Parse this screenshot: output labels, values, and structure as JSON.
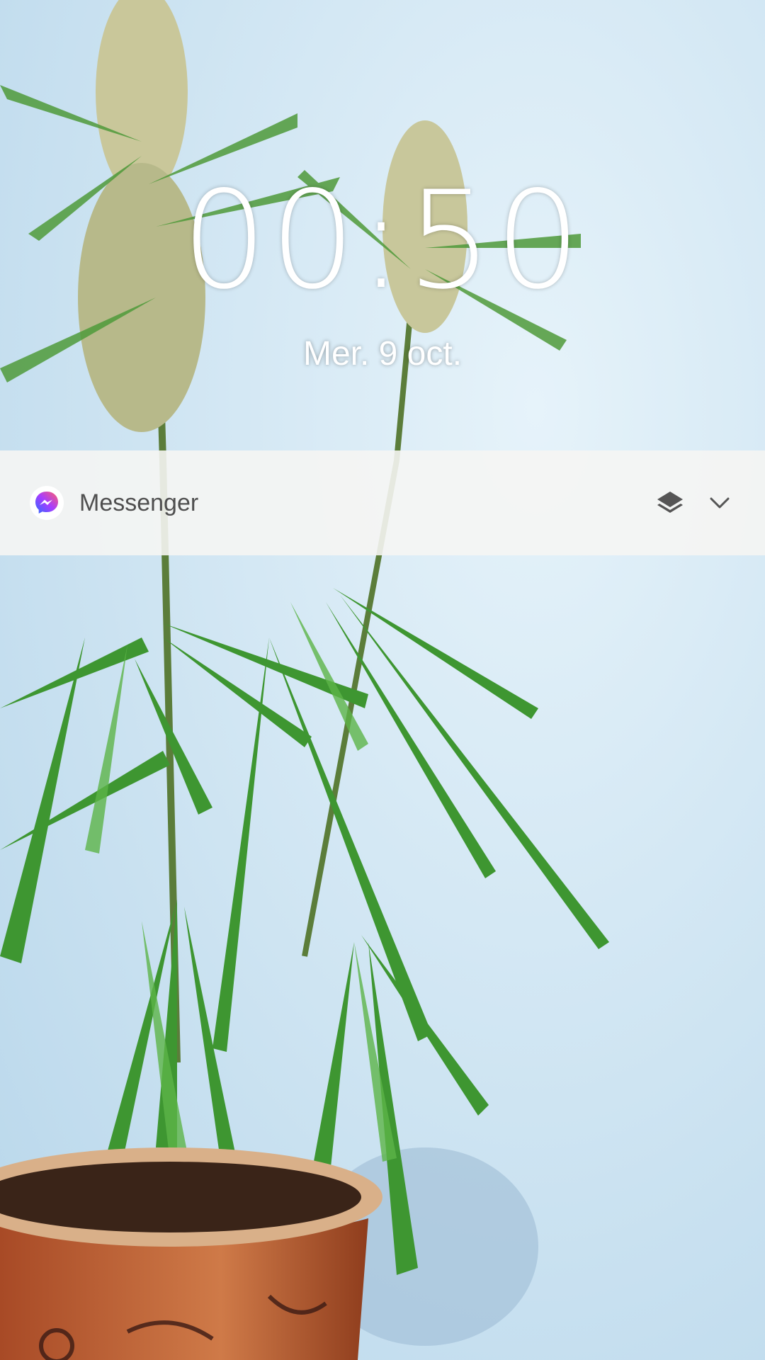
{
  "lockscreen": {
    "time": "00:50",
    "date": "Mer. 9 oct."
  },
  "notification": {
    "app_name": "Messenger",
    "app_icon": "messenger-icon",
    "actions": [
      {
        "icon": "layers-icon"
      },
      {
        "icon": "chevron-down-icon"
      }
    ]
  },
  "wallpaper": {
    "subject": "potted plant",
    "colors": {
      "sky": "#d2e8f4",
      "leaf": "#3f9a32",
      "pot": "#c2643a"
    }
  }
}
